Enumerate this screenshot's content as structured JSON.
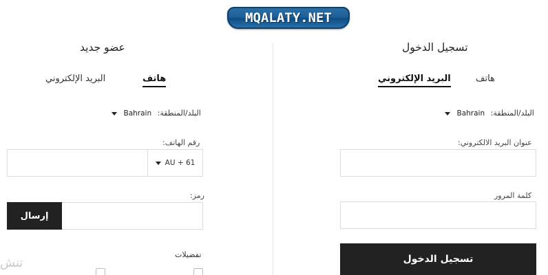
{
  "logo": {
    "text": "MQALATY.NET"
  },
  "login": {
    "title": "تسجيل الدخول",
    "tabs": {
      "email": "البريد الإلكتروني",
      "phone": "هاتف"
    },
    "region_label": "البلد/المنطقة:",
    "region_value": "Bahrain",
    "email_label": "عنوان البريد الالكتروني:",
    "password_label": "كلمة المرور",
    "submit_label": "تسجيل الدخول"
  },
  "register": {
    "title": "عضو جديد",
    "tabs": {
      "phone": "هاتف",
      "email": "البريد الإلكتروني"
    },
    "region_label": "البلد/المنطقة:",
    "region_value": "Bahrain",
    "phone_label": "رقم الهاتف:",
    "phone_code": "AU + 61",
    "code_label": "رمز:",
    "send_label": "إرسال",
    "prefs_label": "تفضيلات",
    "faint_text": "تنش"
  }
}
